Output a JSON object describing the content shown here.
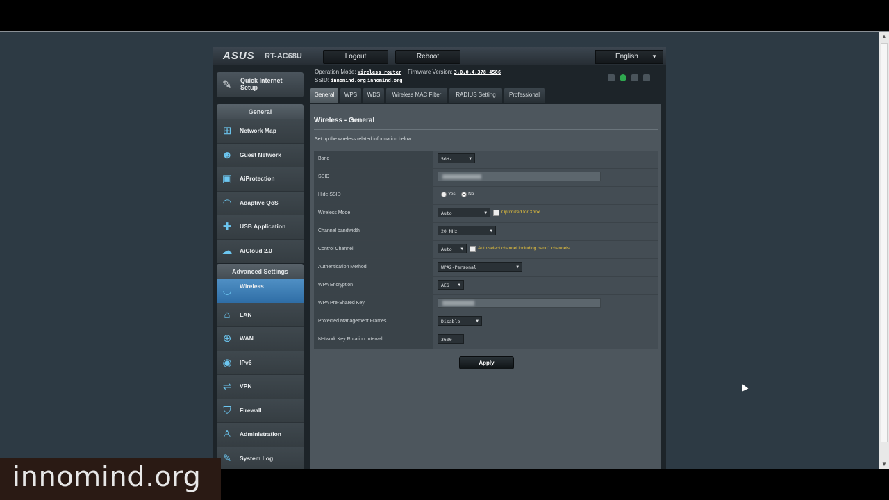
{
  "header": {
    "logo": "ASUS",
    "model": "RT-AC68U",
    "logout_label": "Logout",
    "reboot_label": "Reboot",
    "language": "English"
  },
  "info": {
    "operation_mode_label": "Operation Mode:",
    "operation_mode_value": "Wireless router",
    "firmware_label": "Firmware Version:",
    "firmware_value": "3.0.0.4.378_4586",
    "ssid_label": "SSID:",
    "ssid_value_1": "innomind.org",
    "ssid_value_2": "innomind.org"
  },
  "sidebar": {
    "quick_setup": "Quick Internet Setup",
    "general_header": "General",
    "general_items": [
      {
        "label": "Network Map",
        "icon": "network-map-icon"
      },
      {
        "label": "Guest Network",
        "icon": "guest-network-icon"
      },
      {
        "label": "AiProtection",
        "icon": "lock-icon"
      },
      {
        "label": "Adaptive QoS",
        "icon": "gauge-icon"
      },
      {
        "label": "USB Application",
        "icon": "puzzle-icon"
      },
      {
        "label": "AiCloud 2.0",
        "icon": "cloud-icon"
      }
    ],
    "advanced_header": "Advanced Settings",
    "advanced_items": [
      {
        "label": "Wireless",
        "icon": "wifi-icon"
      },
      {
        "label": "LAN",
        "icon": "home-icon"
      },
      {
        "label": "WAN",
        "icon": "globe-icon"
      },
      {
        "label": "IPv6",
        "icon": "ipv6-icon"
      },
      {
        "label": "VPN",
        "icon": "vpn-icon"
      },
      {
        "label": "Firewall",
        "icon": "shield-icon"
      },
      {
        "label": "Administration",
        "icon": "admin-icon"
      },
      {
        "label": "System Log",
        "icon": "log-icon"
      }
    ]
  },
  "tabs": [
    "General",
    "WPS",
    "WDS",
    "Wireless MAC Filter",
    "RADIUS Setting",
    "Professional"
  ],
  "content": {
    "title": "Wireless - General",
    "description": "Set up the wireless related information below.",
    "rows": {
      "band": {
        "label": "Band",
        "value": "5GHz"
      },
      "ssid": {
        "label": "SSID"
      },
      "hide_ssid": {
        "label": "Hide SSID",
        "yes": "Yes",
        "no": "No"
      },
      "wireless_mode": {
        "label": "Wireless Mode",
        "value": "Auto",
        "hint": "Optimized for Xbox"
      },
      "channel_bandwidth": {
        "label": "Channel bandwidth",
        "value": "20 MHz"
      },
      "control_channel": {
        "label": "Control Channel",
        "value": "Auto",
        "hint": "Auto select channel including band1 channels"
      },
      "auth_method": {
        "label": "Authentication Method",
        "value": "WPA2-Personal"
      },
      "wpa_encryption": {
        "label": "WPA Encryption",
        "value": "AES"
      },
      "wpa_key": {
        "label": "WPA Pre-Shared Key"
      },
      "pmf": {
        "label": "Protected Management Frames",
        "value": "Disable"
      },
      "rotation": {
        "label": "Network Key Rotation Interval",
        "value": "3600"
      }
    },
    "apply_label": "Apply"
  },
  "watermark": "innomind.org"
}
